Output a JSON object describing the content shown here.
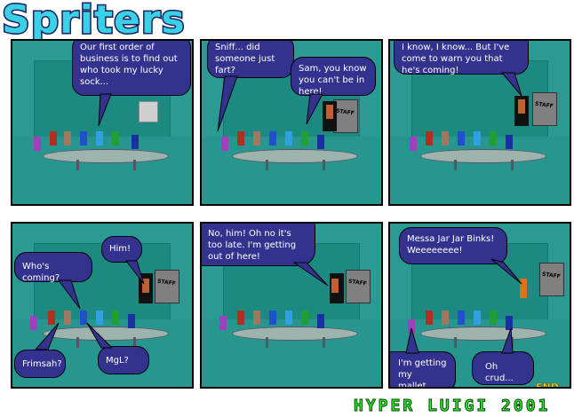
{
  "title": "Spriters",
  "credit": "HYPER LUIGI 2001",
  "end_label": "END",
  "door_sign": "STAFF",
  "colors": {
    "bubble": "#33338f",
    "wall": "#2a9a92",
    "title_fill": "#3ad0e6",
    "credit": "#1eff1e"
  },
  "panels": [
    {
      "id": 1,
      "bubbles": [
        {
          "text": "Our first order of business is to find out who took my lucky sock..."
        }
      ]
    },
    {
      "id": 2,
      "bubbles": [
        {
          "text": "Sniff... did someone just fart?"
        },
        {
          "text": "Sam, you know you can't be in here!"
        }
      ]
    },
    {
      "id": 3,
      "bubbles": [
        {
          "text": "I know, I know... But I've come to warn you that he's coming!"
        }
      ]
    },
    {
      "id": 4,
      "bubbles": [
        {
          "text": "Who's coming?"
        },
        {
          "text": "Him!"
        },
        {
          "text": "Frimsah?"
        },
        {
          "text": "MgL?"
        }
      ]
    },
    {
      "id": 5,
      "bubbles": [
        {
          "text": "No, him! Oh no it's too late. I'm getting out of here!"
        }
      ]
    },
    {
      "id": 6,
      "bubbles": [
        {
          "text": "Messa Jar Jar Binks! Weeeeeeee!"
        },
        {
          "text": "I'm getting my mallet..."
        },
        {
          "text": "Oh crud..."
        }
      ]
    }
  ]
}
